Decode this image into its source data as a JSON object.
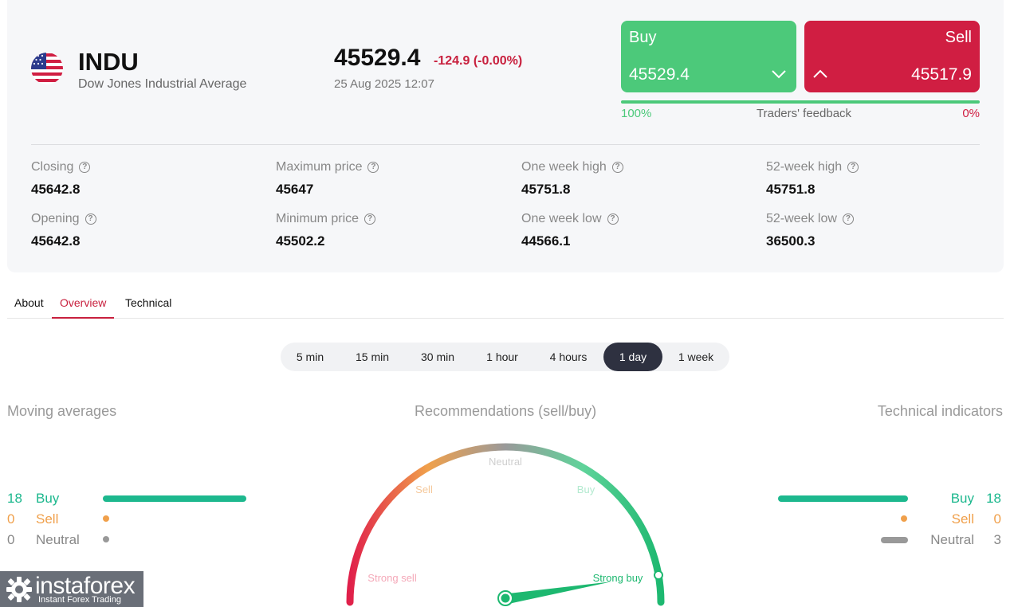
{
  "instrument": {
    "symbol": "INDU",
    "name": "Dow Jones Industrial Average",
    "flag_icon": "us-flag-icon",
    "price": "45529.4",
    "change": "-124.9 (-0.00%)",
    "datetime": "25 Aug 2025 12:07"
  },
  "trade": {
    "buy_label": "Buy",
    "buy_price": "45529.4",
    "sell_label": "Sell",
    "sell_price": "45517.9",
    "feedback_label": "Traders' feedback",
    "buy_percent_label": "100%",
    "sell_percent_label": "0%",
    "buy_fraction": 1.0
  },
  "stats": [
    {
      "label": "Closing",
      "value": "45642.8"
    },
    {
      "label": "Maximum price",
      "value": "45647"
    },
    {
      "label": "One week high",
      "value": "45751.8"
    },
    {
      "label": "52-week high",
      "value": "45751.8"
    },
    {
      "label": "Opening",
      "value": "45642.8"
    },
    {
      "label": "Minimum price",
      "value": "45502.2"
    },
    {
      "label": "One week low",
      "value": "44566.1"
    },
    {
      "label": "52-week low",
      "value": "36500.3"
    }
  ],
  "help_glyph": "?",
  "tabs": [
    {
      "label": "About",
      "active": false
    },
    {
      "label": "Overview",
      "active": true
    },
    {
      "label": "Technical",
      "active": false
    }
  ],
  "periods": [
    {
      "label": "5 min",
      "active": false
    },
    {
      "label": "15 min",
      "active": false
    },
    {
      "label": "30 min",
      "active": false
    },
    {
      "label": "1 hour",
      "active": false
    },
    {
      "label": "4 hours",
      "active": false
    },
    {
      "label": "1 day",
      "active": true
    },
    {
      "label": "1 week",
      "active": false
    }
  ],
  "moving_averages": {
    "title": "Moving averages",
    "buy": {
      "count": "18",
      "label": "Buy"
    },
    "sell": {
      "count": "0",
      "label": "Sell"
    },
    "neutral": {
      "count": "0",
      "label": "Neutral"
    }
  },
  "recommendations": {
    "title": "Recommendations (sell/buy)",
    "labels": {
      "strong_sell": "Strong sell",
      "sell": "Sell",
      "neutral": "Neutral",
      "buy": "Buy",
      "strong_buy": "Strong buy"
    },
    "needle_value": "strong buy"
  },
  "technical_indicators": {
    "title": "Technical indicators",
    "buy": {
      "count": "18",
      "label": "Buy"
    },
    "sell": {
      "count": "0",
      "label": "Sell"
    },
    "neutral": {
      "count": "3",
      "label": "Neutral"
    }
  },
  "colors": {
    "buy": "#4cc97a",
    "sell": "#d01e42",
    "ma_buy": "#1db88e",
    "ma_sell": "#f0a04b",
    "neutral": "#999999"
  },
  "watermark": {
    "brand": "instaforex",
    "tagline": "Instant Forex Trading"
  }
}
